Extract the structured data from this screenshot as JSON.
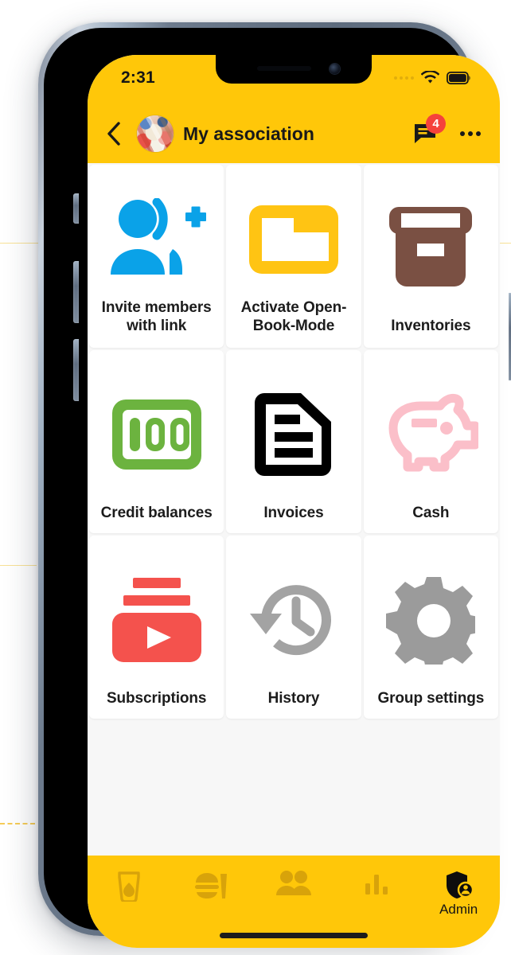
{
  "status_bar": {
    "time": "2:31",
    "signal_icon": "signal-dots-icon",
    "wifi_icon": "wifi-icon",
    "battery_icon": "battery-full-icon"
  },
  "app_bar": {
    "back_icon": "back-chevron-icon",
    "avatar_icon": "group-avatar-image",
    "title": "My association",
    "messages_icon": "chat-bubble-icon",
    "messages_badge": "4",
    "overflow_icon": "more-options-icon"
  },
  "grid": {
    "tiles": [
      {
        "label": "Invite members with link",
        "icon": "person-add-invite-icon",
        "color": "#0aa2e8"
      },
      {
        "label": "Activate Open-Book-Mode",
        "icon": "folder-icon",
        "color": "#ffc413"
      },
      {
        "label": "Inventories",
        "icon": "archive-box-icon",
        "color": "#7a5043"
      },
      {
        "label": "Credit balances",
        "icon": "banknote-100-icon",
        "color": "#6cb33f"
      },
      {
        "label": "Invoices",
        "icon": "document-lines-icon",
        "color": "#000000"
      },
      {
        "label": "Cash",
        "icon": "piggy-bank-icon",
        "color": "#fbbfc9"
      },
      {
        "label": "Subscriptions",
        "icon": "subscriptions-play-icon",
        "color": "#f4524d"
      },
      {
        "label": "History",
        "icon": "clock-rotate-left-icon",
        "color": "#a3a3a3"
      },
      {
        "label": "Group settings",
        "icon": "gear-icon",
        "color": "#9b9b9b"
      }
    ]
  },
  "bottom_nav": {
    "items": [
      {
        "label": "",
        "icon": "drink-glass-icon",
        "active": false
      },
      {
        "label": "",
        "icon": "food-tray-icon",
        "active": false
      },
      {
        "label": "",
        "icon": "people-icon",
        "active": false
      },
      {
        "label": "",
        "icon": "bar-chart-icon",
        "active": false
      },
      {
        "label": "Admin",
        "icon": "shield-person-icon",
        "active": true
      }
    ]
  },
  "colors": {
    "brand_yellow": "#ffc709",
    "nav_inactive": "#d8a30a",
    "badge_red": "#f5423c",
    "screen_bg": "#f7f7f7"
  }
}
